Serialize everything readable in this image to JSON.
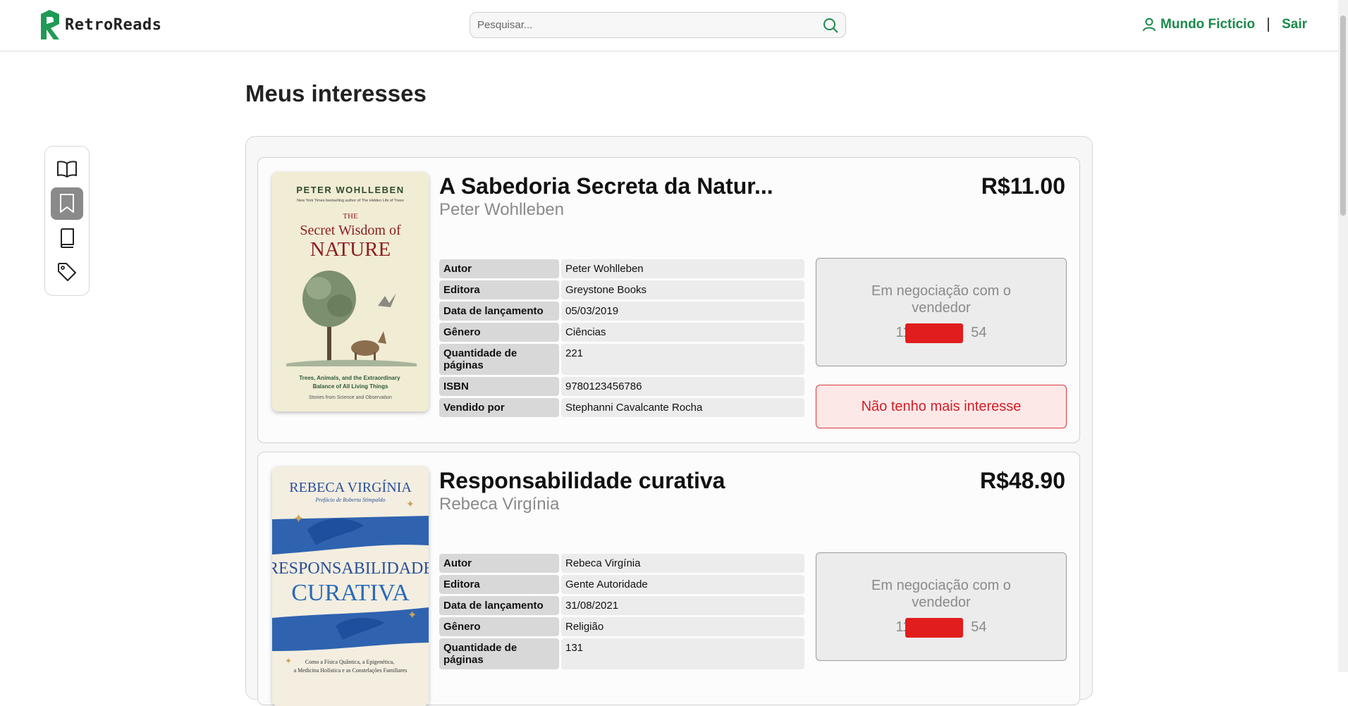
{
  "header": {
    "logo_text": "RetroReads",
    "search_placeholder": "Pesquisar...",
    "user_name": "Mundo Ficticio",
    "logout_label": "Sair"
  },
  "page_title": "Meus interesses",
  "colors": {
    "brand_green": "#1a8a4a",
    "danger_red": "#d31e26",
    "danger_bg": "#fde8e8"
  },
  "sidebar": {
    "items": [
      {
        "icon": "open-book-icon",
        "active": false
      },
      {
        "icon": "bookmark-icon",
        "active": true
      },
      {
        "icon": "closed-book-icon",
        "active": false
      },
      {
        "icon": "tag-icon",
        "active": false
      }
    ]
  },
  "books": [
    {
      "title": "A Sabedoria Secreta da Natur...",
      "author": "Peter Wohlleben",
      "price": "R$11.00",
      "cover": {
        "top": "PETER WOHLLEBEN",
        "sub": "New York Times bestselling author of The Hidden Life of Trees",
        "the": "THE",
        "line1": "Secret Wisdom of",
        "line2": "NATURE",
        "tagline": "Trees, Animals, and the Extraordinary Balance of All Living Things",
        "foot": "Stories from Science and Observation"
      },
      "specs": [
        {
          "label": "Autor",
          "value": "Peter Wohlleben"
        },
        {
          "label": "Editora",
          "value": "Greystone Books"
        },
        {
          "label": "Data de lançamento",
          "value": "05/03/2019"
        },
        {
          "label": "Gênero",
          "value": "Ciências"
        },
        {
          "label": "Quantidade de páginas",
          "value": "221"
        },
        {
          "label": "ISBN",
          "value": "9780123456786"
        },
        {
          "label": "Vendido por",
          "value": "Stephanni Cavalcante Rocha"
        }
      ],
      "negotiation_text": "Em negociação com o vendedor",
      "phone_start": "11",
      "phone_end": "54",
      "remove_label": "Não tenho mais interesse"
    },
    {
      "title": "Responsabilidade curativa",
      "author": "Rebeca Virgínia",
      "price": "R$48.90",
      "cover": {
        "top": "REBECA VIRGÍNIA",
        "sub": "Prefácio de Roberta Stimpaldo",
        "line1": "RESPONSABILIDADE",
        "line2": "CURATIVA",
        "foot": "Como a Física Quântica, a Epigenética, a Medicina Holística e as Constelações Familiares"
      },
      "specs": [
        {
          "label": "Autor",
          "value": "Rebeca Virgínia"
        },
        {
          "label": "Editora",
          "value": "Gente Autoridade"
        },
        {
          "label": "Data de lançamento",
          "value": "31/08/2021"
        },
        {
          "label": "Gênero",
          "value": "Religião"
        },
        {
          "label": "Quantidade de páginas",
          "value": "131"
        }
      ],
      "negotiation_text": "Em negociação com o vendedor",
      "phone_start": "11",
      "phone_end": "54"
    }
  ]
}
